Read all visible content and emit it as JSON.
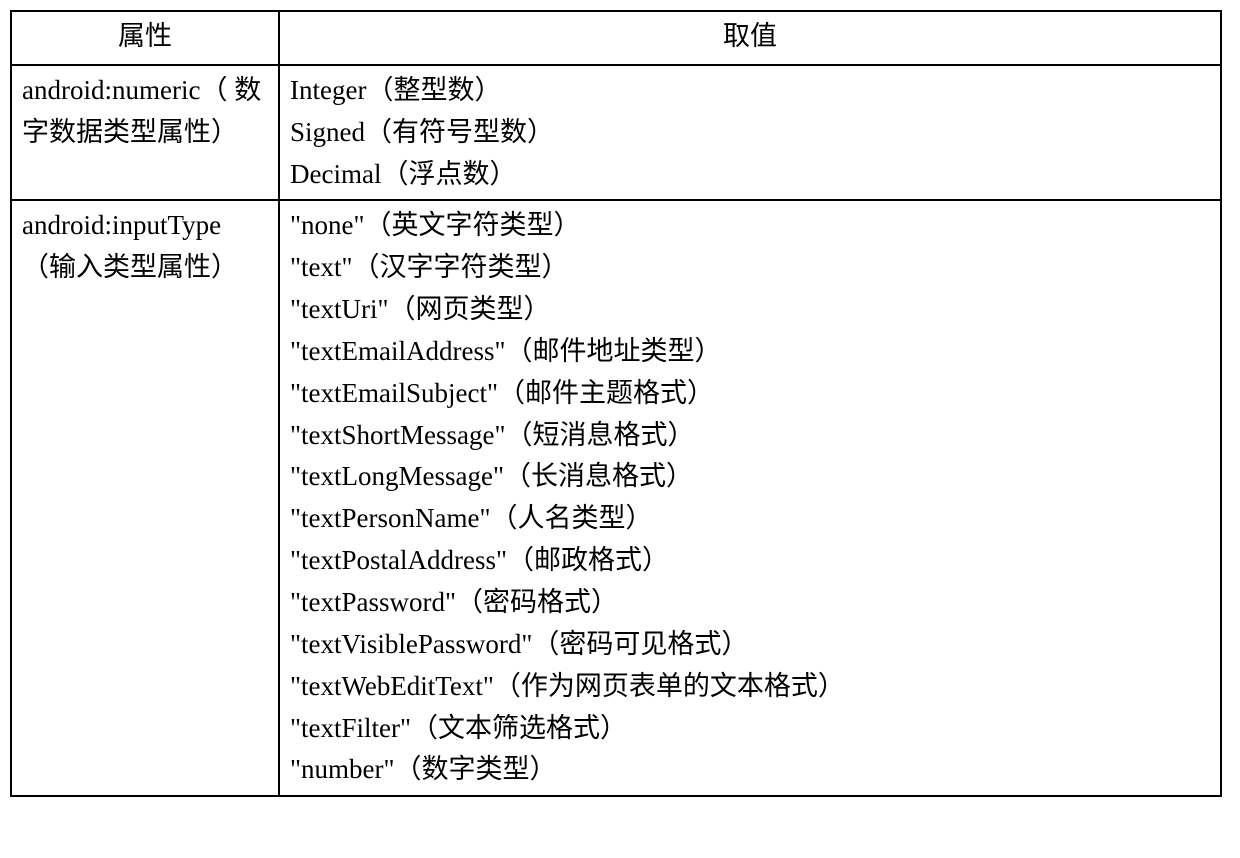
{
  "headers": {
    "attribute": "属性",
    "value": "取值"
  },
  "rows": [
    {
      "attribute": "android:numeric（ 数字数据类型属性）",
      "values": [
        "Integer（整型数）",
        "Signed（有符号型数）",
        "Decimal（浮点数）"
      ]
    },
    {
      "attribute": "android:inputType（输入类型属性）",
      "values": [
        "\"none\"（英文字符类型）",
        "\"text\"（汉字字符类型）",
        "\"textUri\"（网页类型）",
        "\"textEmailAddress\"（邮件地址类型）",
        "\"textEmailSubject\"（邮件主题格式）",
        "\"textShortMessage\"（短消息格式）",
        "\"textLongMessage\"（长消息格式）",
        "\"textPersonName\"（人名类型）",
        "\"textPostalAddress\"（邮政格式）",
        "\"textPassword\"（密码格式）",
        "\"textVisiblePassword\"（密码可见格式）",
        "\"textWebEditText\"（作为网页表单的文本格式）",
        "\"textFilter\"（文本筛选格式）",
        "\"number\"（数字类型）"
      ]
    }
  ]
}
